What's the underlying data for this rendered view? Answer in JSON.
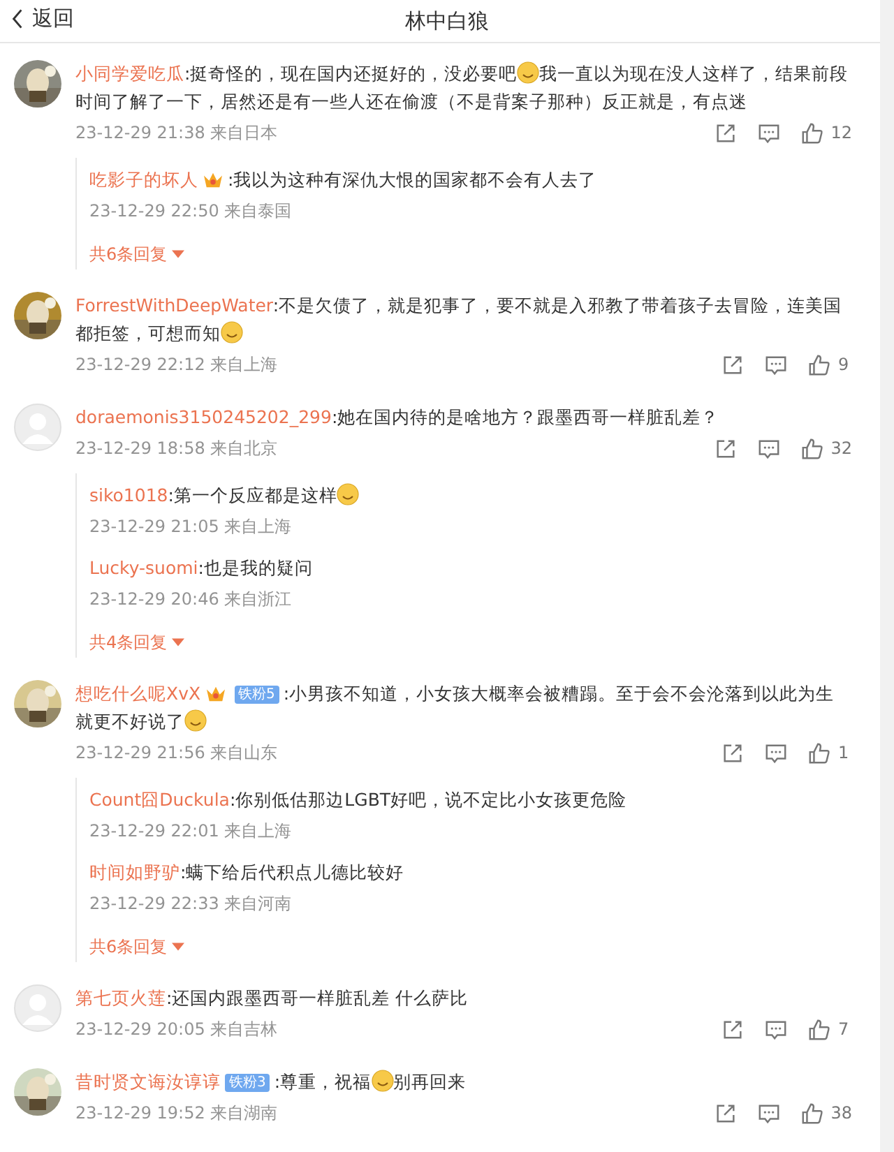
{
  "header": {
    "back": "返回",
    "title": "林中白狼"
  },
  "comments": [
    {
      "kind": "picture",
      "user": "小同学爱吃瓜",
      "segments": [
        {
          "kind": "text",
          "text": ":挺奇怪的，现在国内还挺好的，没必要吧"
        },
        {
          "kind": "emoji"
        },
        {
          "kind": "text",
          "text": "我一直以为现在没人这样了，结果前段时间了解了一下，居然还是有一些人还在偷渡（不是背案子那种）反正就是，有点迷"
        }
      ],
      "time": "23-12-29 21:38",
      "location": "来自日本",
      "likes": "12",
      "replies": [
        {
          "user": "吃影子的坏人",
          "badges": [
            {
              "kind": "crown"
            }
          ],
          "segments": [
            {
              "kind": "text",
              "text": ":我以为这种有深仇大恨的国家都不会有人去了"
            }
          ],
          "time": "23-12-29 22:50",
          "location": "来自泰国"
        }
      ],
      "more": "共6条回复"
    },
    {
      "kind": "picture",
      "user": "ForrestWithDeepWater",
      "segments": [
        {
          "kind": "text",
          "text": ":不是欠债了，就是犯事了，要不就是入邪教了带着孩子去冒险，连美国都拒签，可想而知"
        },
        {
          "kind": "emoji"
        }
      ],
      "time": "23-12-29 22:12",
      "location": "来自上海",
      "likes": "9"
    },
    {
      "kind": "default_avatar",
      "user": "doraemonis3150245202_299",
      "segments": [
        {
          "kind": "text",
          "text": ":她在国内待的是啥地方？跟墨西哥一样脏乱差？"
        }
      ],
      "time": "23-12-29 18:58",
      "location": "来自北京",
      "likes": "32",
      "replies": [
        {
          "user": "siko1018",
          "segments": [
            {
              "kind": "text",
              "text": ":第一个反应都是这样"
            },
            {
              "kind": "emoji"
            }
          ],
          "time": "23-12-29 21:05",
          "location": "来自上海"
        },
        {
          "user": "Lucky-suomi",
          "segments": [
            {
              "kind": "text",
              "text": ":也是我的疑问"
            }
          ],
          "time": "23-12-29 20:46",
          "location": "来自浙江"
        }
      ],
      "more": "共4条回复"
    },
    {
      "kind": "picture",
      "user": "想吃什么呢XvX",
      "badges": [
        {
          "kind": "crown"
        },
        {
          "kind": "fan",
          "label": "铁粉5"
        }
      ],
      "segments": [
        {
          "kind": "text",
          "text": ":小男孩不知道，小女孩大概率会被糟蹋。至于会不会沦落到以此为生就更不好说了"
        },
        {
          "kind": "emoji"
        }
      ],
      "time": "23-12-29 21:56",
      "location": "来自山东",
      "likes": "1",
      "replies": [
        {
          "user": "Count囧Duckula",
          "segments": [
            {
              "kind": "text",
              "text": ":你别低估那边LGBT好吧，说不定比小女孩更危险"
            }
          ],
          "time": "23-12-29 22:01",
          "location": "来自上海"
        },
        {
          "user": "时间如野驴",
          "segments": [
            {
              "kind": "text",
              "text": ":螨下给后代积点儿德比较好"
            }
          ],
          "time": "23-12-29 22:33",
          "location": "来自河南"
        }
      ],
      "more": "共6条回复"
    },
    {
      "kind": "default_avatar",
      "user": "第七页火莲",
      "segments": [
        {
          "kind": "text",
          "text": ":还国内跟墨西哥一样脏乱差 什么萨比"
        }
      ],
      "time": "23-12-29 20:05",
      "location": "来自吉林",
      "likes": "7"
    },
    {
      "kind": "picture",
      "user": "昔时贤文诲汝谆谆",
      "badges": [
        {
          "kind": "fan",
          "label": "铁粉3"
        }
      ],
      "segments": [
        {
          "kind": "text",
          "text": ":尊重，祝福"
        },
        {
          "kind": "emoji"
        },
        {
          "kind": "text",
          "text": "别再回来"
        }
      ],
      "time": "23-12-29 19:52",
      "location": "来自湖南",
      "likes": "38"
    }
  ]
}
